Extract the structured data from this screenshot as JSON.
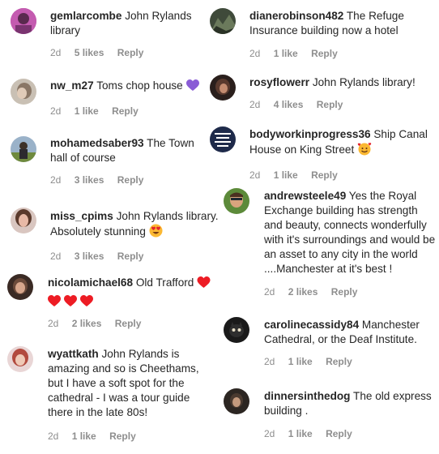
{
  "left_comments": [
    {
      "username": "gemlarcombe",
      "text": "John Rylands library",
      "time": "2d",
      "likes": "5 likes",
      "reply": "Reply"
    },
    {
      "username": "nw_m27",
      "text": "Toms chop house",
      "time": "2d",
      "likes": "1 like",
      "reply": "Reply",
      "emoji": "purple-heart"
    },
    {
      "username": "mohamedsaber93",
      "text": "The Town hall of course",
      "time": "2d",
      "likes": "3 likes",
      "reply": "Reply"
    },
    {
      "username": "miss_cpims",
      "text": "John Rylands library. Absolutely stunning",
      "time": "2d",
      "likes": "3 likes",
      "reply": "Reply",
      "emoji": "heart-eyes"
    },
    {
      "username": "nicolamichael68",
      "text": "Old Trafford",
      "time": "2d",
      "likes": "2 likes",
      "reply": "Reply",
      "emoji": "red-hearts"
    },
    {
      "username": "wyattkath",
      "text": "John Rylands is amazing and so is Cheethams, but I have a soft spot for the cathedral - I was a tour guide there in the late 80s!",
      "time": "2d",
      "likes": "1 like",
      "reply": "Reply"
    }
  ],
  "right_comments": [
    {
      "username": "dianerobinson482",
      "text": "The Refuge Insurance building now a hotel",
      "time": "2d",
      "likes": "1 like",
      "reply": "Reply"
    },
    {
      "username": "rosyflowerr",
      "text": "John Rylands library!",
      "time": "2d",
      "likes": "4 likes",
      "reply": "Reply"
    },
    {
      "username": "bodyworkinprogress36",
      "text": "Ship Canal House on King Street",
      "time": "2d",
      "likes": "1 like",
      "reply": "Reply",
      "emoji": "smiling-hearts"
    },
    {
      "username": "andrewsteele49",
      "text": "Yes the Royal Exchange building has strength and beauty, connects wonderfully with it's surroundings and would be an asset to any city in the world ....Manchester at it's best !",
      "time": "2d",
      "likes": "2 likes",
      "reply": "Reply"
    },
    {
      "username": "carolinecassidy84",
      "text": "Manchester Cathedral, or the Deaf Institute.",
      "time": "2d",
      "likes": "1 like",
      "reply": "Reply"
    },
    {
      "username": "dinnersinthedog",
      "text": "The old express building .",
      "time": "2d",
      "likes": "1 like",
      "reply": "Reply"
    }
  ],
  "colors": {
    "text": "#262626",
    "meta": "#8e8e8e",
    "heart_red": "#ed1c24",
    "heart_purple": "#8a5cd6"
  }
}
